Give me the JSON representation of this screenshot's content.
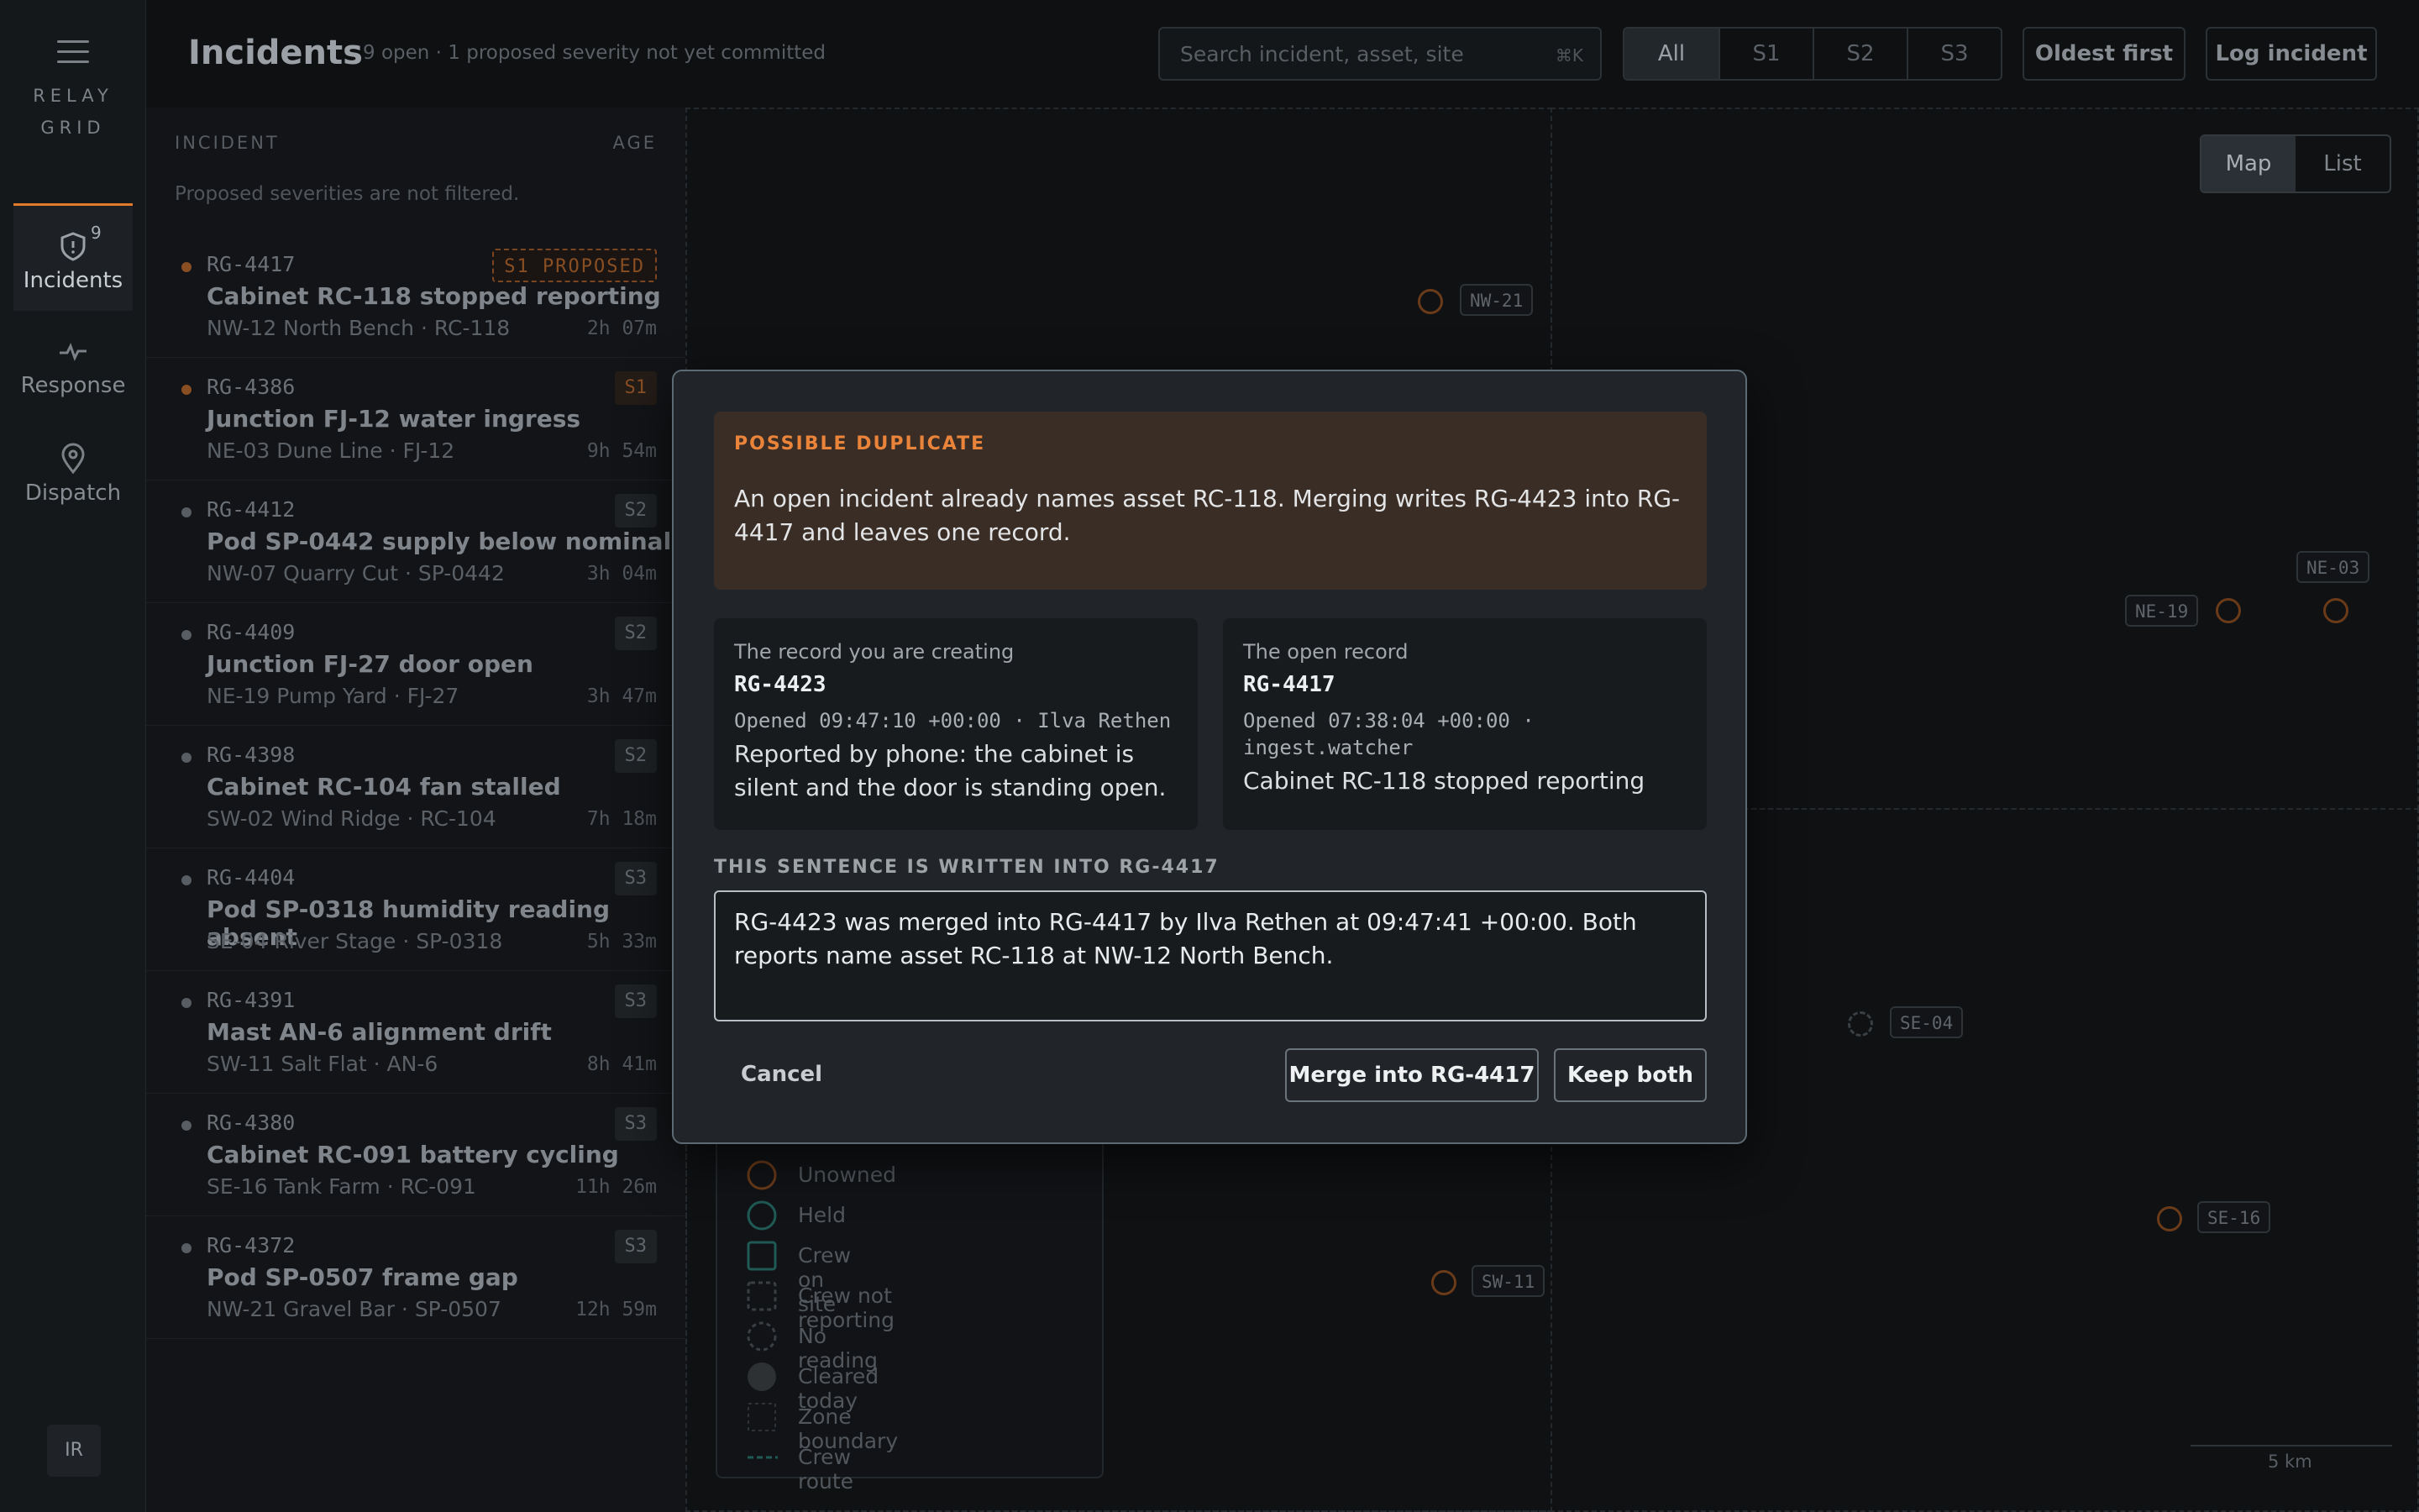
{
  "rail": {
    "brand_line1": "RELAY",
    "brand_line2": "GRID",
    "nav": [
      {
        "label": "Incidents",
        "badge": "9",
        "icon": "shield-icon"
      },
      {
        "label": "Response",
        "icon": "pulse-icon"
      },
      {
        "label": "Dispatch",
        "icon": "location-pin-icon"
      }
    ],
    "avatar": "IR"
  },
  "header": {
    "title": "Incidents",
    "subtitle": "9 open · 1 proposed severity not yet committed",
    "search_placeholder": "Search incident, asset, site",
    "search_shortcut": "⌘K",
    "filters": [
      "All",
      "S1",
      "S2",
      "S3"
    ],
    "sort_label": "Oldest first",
    "log_label": "Log incident"
  },
  "list": {
    "col_incident": "INCIDENT",
    "col_age": "AGE",
    "note": "Proposed severities are not filtered.",
    "rows": [
      {
        "id": "RG-4417",
        "sev": "S1 PROPOSED",
        "title": "Cabinet RC-118 stopped reporting",
        "meta": "NW-12 North Bench · RC-118",
        "age": "2h 07m"
      },
      {
        "id": "RG-4386",
        "sev": "S1",
        "title": "Junction FJ-12 water ingress",
        "meta": "NE-03 Dune Line · FJ-12",
        "age": "9h 54m"
      },
      {
        "id": "RG-4412",
        "sev": "S2",
        "title": "Pod SP-0442 supply below nominal",
        "meta": "NW-07 Quarry Cut · SP-0442",
        "age": "3h 04m"
      },
      {
        "id": "RG-4409",
        "sev": "S2",
        "title": "Junction FJ-27 door open",
        "meta": "NE-19 Pump Yard · FJ-27",
        "age": "3h 47m"
      },
      {
        "id": "RG-4398",
        "sev": "S2",
        "title": "Cabinet RC-104 fan stalled",
        "meta": "SW-02 Wind Ridge · RC-104",
        "age": "7h 18m"
      },
      {
        "id": "RG-4404",
        "sev": "S3",
        "title": "Pod SP-0318 humidity reading absent",
        "meta": "SE-04 River Stage · SP-0318",
        "age": "5h 33m"
      },
      {
        "id": "RG-4391",
        "sev": "S3",
        "title": "Mast AN-6 alignment drift",
        "meta": "SW-11 Salt Flat · AN-6",
        "age": "8h 41m"
      },
      {
        "id": "RG-4380",
        "sev": "S3",
        "title": "Cabinet RC-091 battery cycling",
        "meta": "SE-16 Tank Farm · RC-091",
        "age": "11h 26m"
      },
      {
        "id": "RG-4372",
        "sev": "S3",
        "title": "Pod SP-0507 frame gap",
        "meta": "NW-21 Gravel Bar · SP-0507",
        "age": "12h 59m"
      }
    ]
  },
  "map": {
    "toggle": [
      "Map",
      "List"
    ],
    "sites": [
      "NW-21",
      "NE-03",
      "NE-19",
      "SE-04",
      "SE-16",
      "SW-11"
    ],
    "legend": [
      "Unowned",
      "Held",
      "Crew on site",
      "Crew not reporting",
      "No reading",
      "Cleared today",
      "Zone boundary",
      "Crew route"
    ],
    "scale": "5 km"
  },
  "modal": {
    "kicker": "POSSIBLE DUPLICATE",
    "message": "An open incident already names asset RC-118. Merging writes RG-4423 into RG-4417 and leaves one record.",
    "new_record": {
      "caption": "The record you are creating",
      "id": "RG-4423",
      "opened": "Opened 09:47:10 +00:00 · Ilva Rethen",
      "desc": "Reported by phone: the cabinet is silent and the door is standing open."
    },
    "open_record": {
      "caption": "The open record",
      "id": "RG-4417",
      "opened": "Opened 07:38:04 +00:00 · ingest.watcher",
      "desc": "Cabinet RC-118 stopped reporting"
    },
    "sentence_label": "THIS SENTENCE IS WRITTEN INTO RG-4417",
    "sentence": "RG-4423 was merged into RG-4417 by Ilva Rethen at 09:47:41 +00:00. Both reports name asset RC-118 at NW-12 North Bench.",
    "cancel": "Cancel",
    "merge": "Merge into RG-4417",
    "keep": "Keep both"
  },
  "colors": {
    "accent": "#e9843a",
    "modal_bg": "#212529",
    "warn_bg": "#3a2d25"
  }
}
